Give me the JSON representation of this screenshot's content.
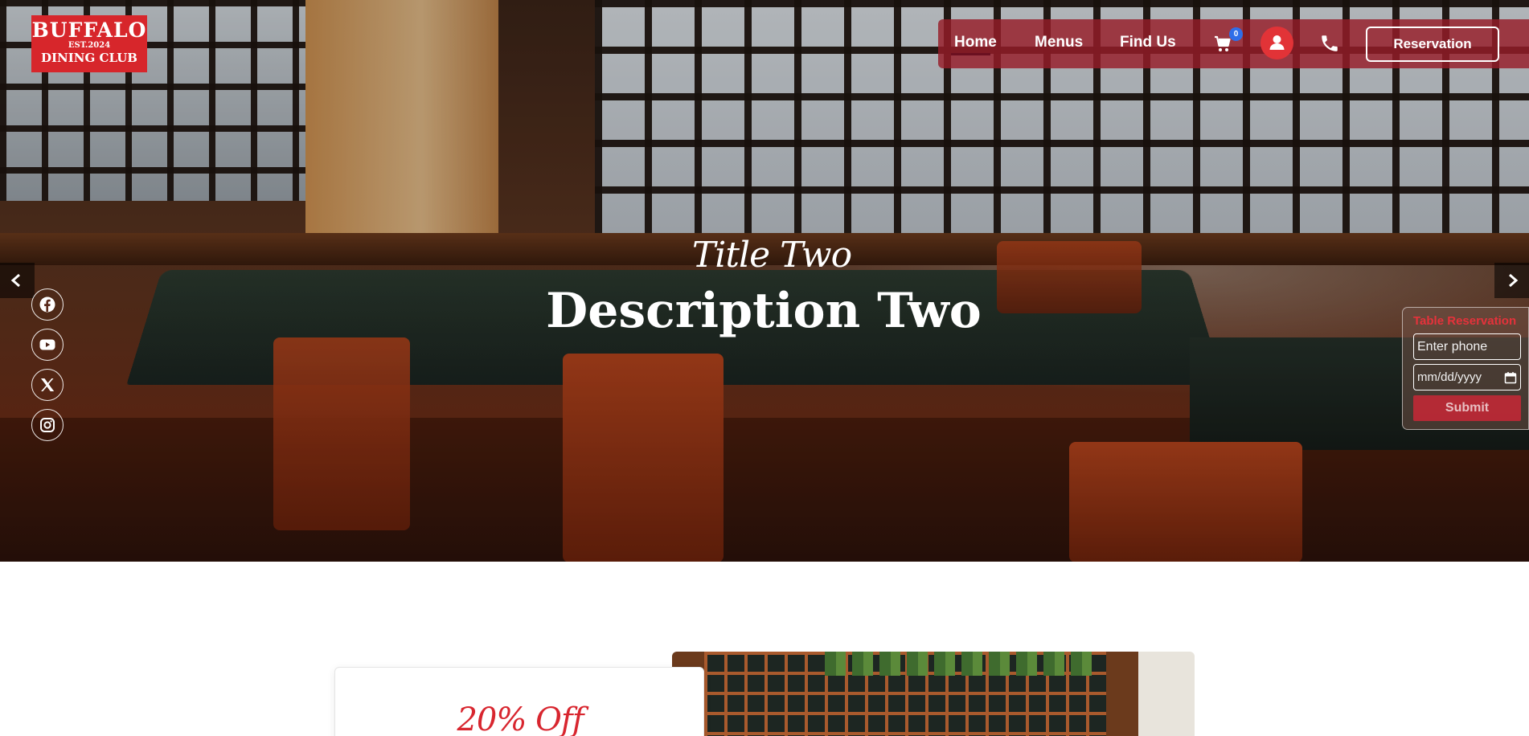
{
  "brand": {
    "name_line1": "BUFFALO",
    "est": "EST.2024",
    "name_line2": "DINING CLUB"
  },
  "nav": {
    "links": [
      "Home",
      "Menus",
      "Find Us"
    ],
    "active": "Home",
    "cart_count": "0",
    "reservation_label": "Reservation",
    "icons": [
      "cart-icon",
      "user-icon",
      "phone-icon"
    ]
  },
  "slide": {
    "title": "Title Two",
    "description": "Description Two"
  },
  "social": [
    "facebook-icon",
    "youtube-icon",
    "x-icon",
    "instagram-icon"
  ],
  "reservation_widget": {
    "title": "Table Reservation",
    "phone_placeholder": "Enter phone",
    "date_placeholder": "mm/dd/yyyy",
    "submit_label": "Submit"
  },
  "promo": {
    "headline": "20% Off"
  },
  "colors": {
    "brand_red": "#d7262b",
    "nav_bg": "#961c28",
    "badge_blue": "#2f6ee8"
  }
}
